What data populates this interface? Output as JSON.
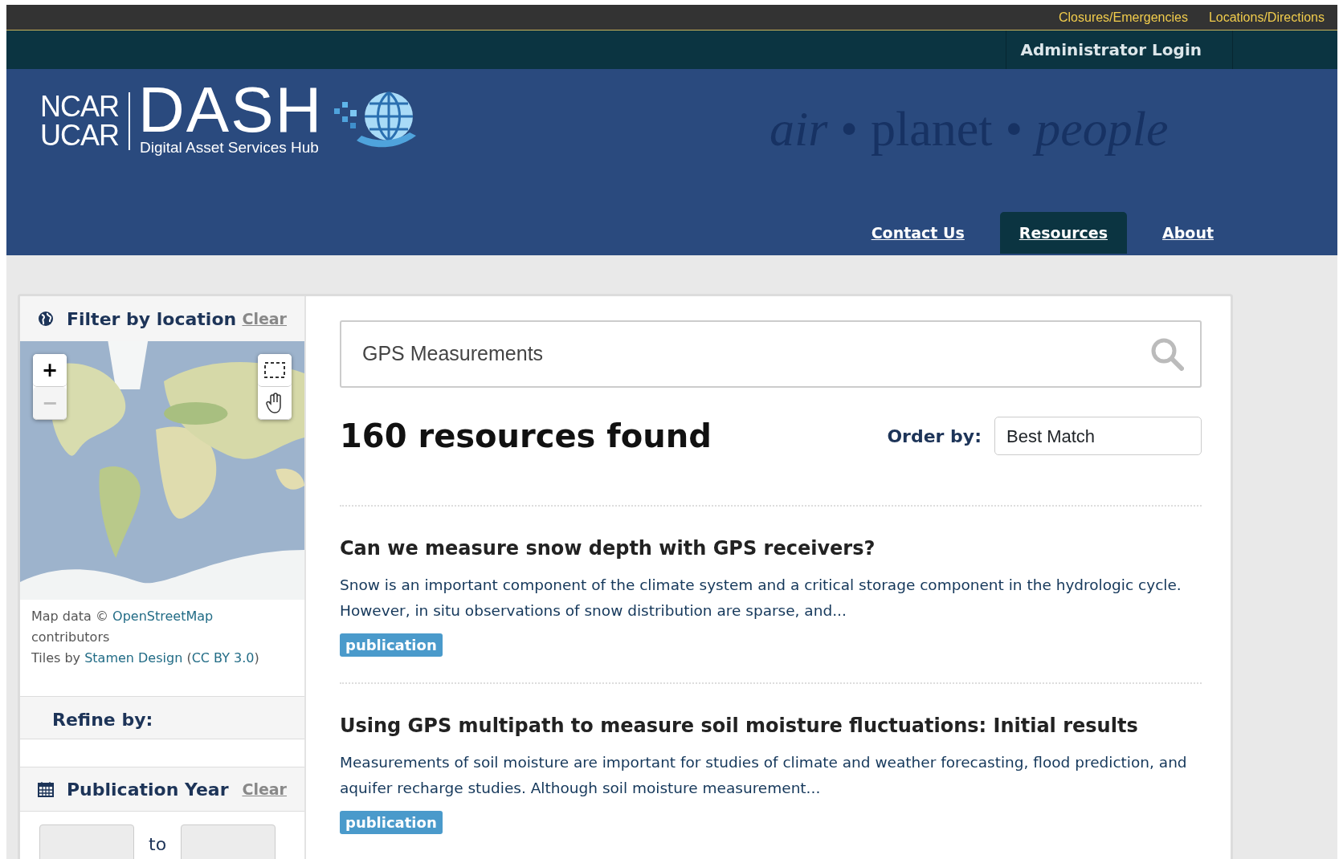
{
  "utility_links": [
    "Closures/Emergencies",
    "Locations/Directions"
  ],
  "admin_link": "Administrator Login",
  "logo": {
    "org_top": "NCAR",
    "org_bottom": "UCAR",
    "name": "DASH",
    "subtitle": "Digital Asset Services Hub"
  },
  "tagline": {
    "word_1": "air",
    "separator_1": "•",
    "word_2": "planet",
    "separator_2": "•",
    "word_3": "people"
  },
  "nav": [
    {
      "label": "Contact Us",
      "selected": false
    },
    {
      "label": "Resources",
      "selected": true
    },
    {
      "label": "About",
      "selected": false
    }
  ],
  "sidebar": {
    "location": {
      "title": "Filter by location",
      "clear": "Clear",
      "map": {
        "kind": "picture",
        "controls": [
          {
            "label": "+",
            "disabled": false
          },
          {
            "label": "−",
            "disabled": true
          }
        ]
      },
      "attribution": {
        "prefix": "Map data © ",
        "osm_link": "OpenStreetMap",
        "middle": " contributors",
        "tiles_prefix": "Tiles by ",
        "stamen_link": "Stamen Design",
        "open": " (",
        "license_link": "CC BY 3.0",
        "close": ")"
      }
    },
    "refine_title": "Refine by:",
    "year": {
      "title": "Publication Year",
      "clear": "Clear",
      "separator": "to"
    }
  },
  "search": {
    "value": "GPS Measurements"
  },
  "results_count": "160 resources found",
  "order": {
    "label": "Order by:",
    "value": "Best Match"
  },
  "results": [
    {
      "title": "Can we measure snow depth with GPS receivers?",
      "summary": "Snow is an important component of the climate system and a critical storage component in the hydrologic cycle. However, in situ observations of snow distribution are sparse, and...",
      "tag": "publication"
    },
    {
      "title": "Using GPS multipath to measure soil moisture fluctuations: Initial results",
      "summary": "Measurements of soil moisture are important for studies of climate and weather forecasting, flood prediction, and aquifer recharge studies. Although soil moisture measurement...",
      "tag": "publication"
    }
  ]
}
